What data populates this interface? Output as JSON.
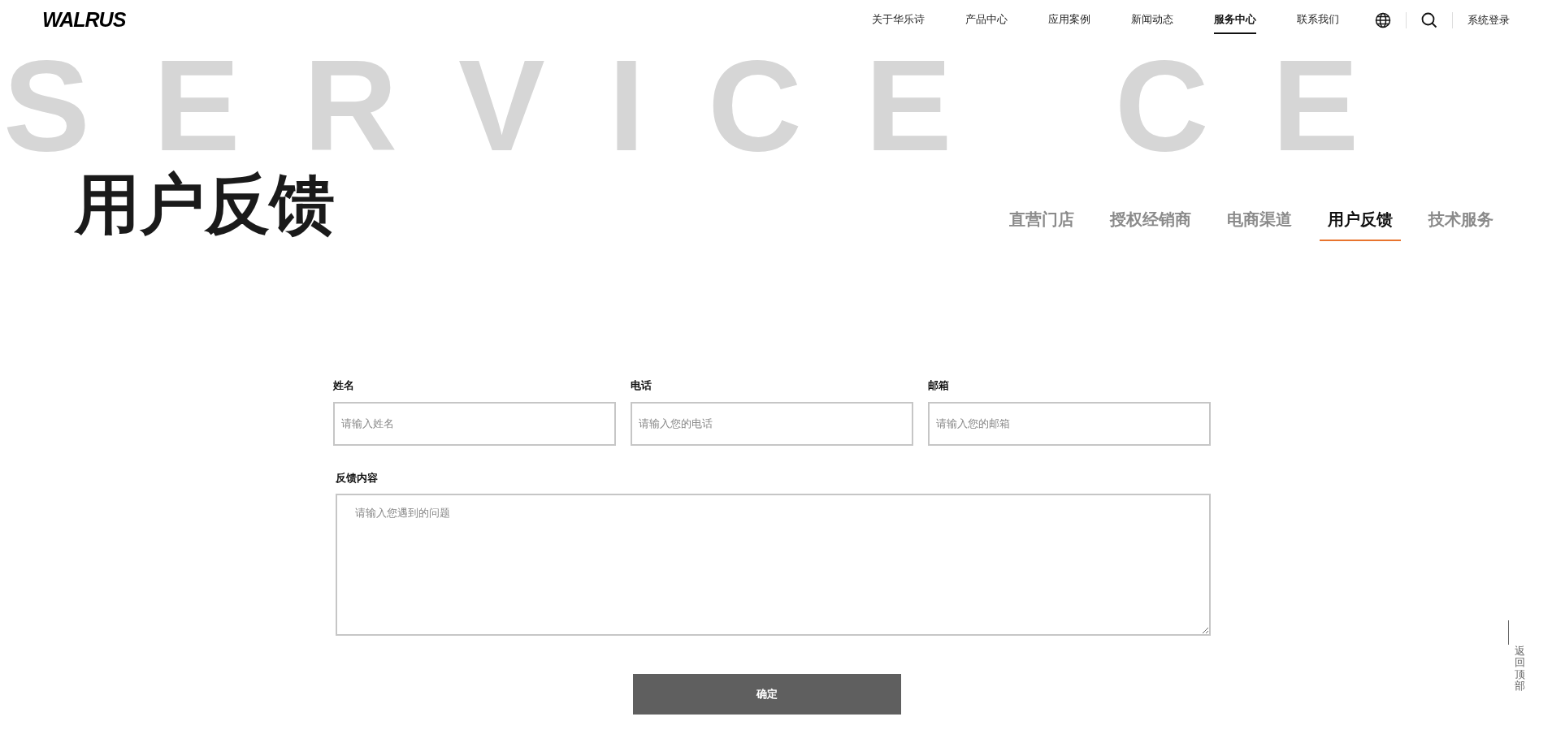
{
  "header": {
    "logo": "WALRUS",
    "nav": [
      {
        "label": "关于华乐诗",
        "selected": false
      },
      {
        "label": "产品中心",
        "selected": false
      },
      {
        "label": "应用案例",
        "selected": false
      },
      {
        "label": "新闻动态",
        "selected": false
      },
      {
        "label": "服务中心",
        "selected": true
      },
      {
        "label": "联系我们",
        "selected": false
      }
    ],
    "login": "系统登录"
  },
  "background_text": "SERVICE CE",
  "page_title": "用户反馈",
  "tabs": [
    {
      "label": "直营门店",
      "selected": false
    },
    {
      "label": "授权经销商",
      "selected": false
    },
    {
      "label": "电商渠道",
      "selected": false
    },
    {
      "label": "用户反馈",
      "selected": true
    },
    {
      "label": "技术服务",
      "selected": false
    }
  ],
  "form": {
    "fields": [
      {
        "label": "姓名",
        "placeholder": "请输入姓名"
      },
      {
        "label": "电话",
        "placeholder": "请输入您的电话"
      },
      {
        "label": "邮箱",
        "placeholder": "请输入您的邮箱"
      }
    ],
    "message": {
      "label": "反馈内容",
      "placeholder": "请输入您遇到的问题"
    },
    "submit": "确定"
  },
  "back_to_top": "返回顶部"
}
